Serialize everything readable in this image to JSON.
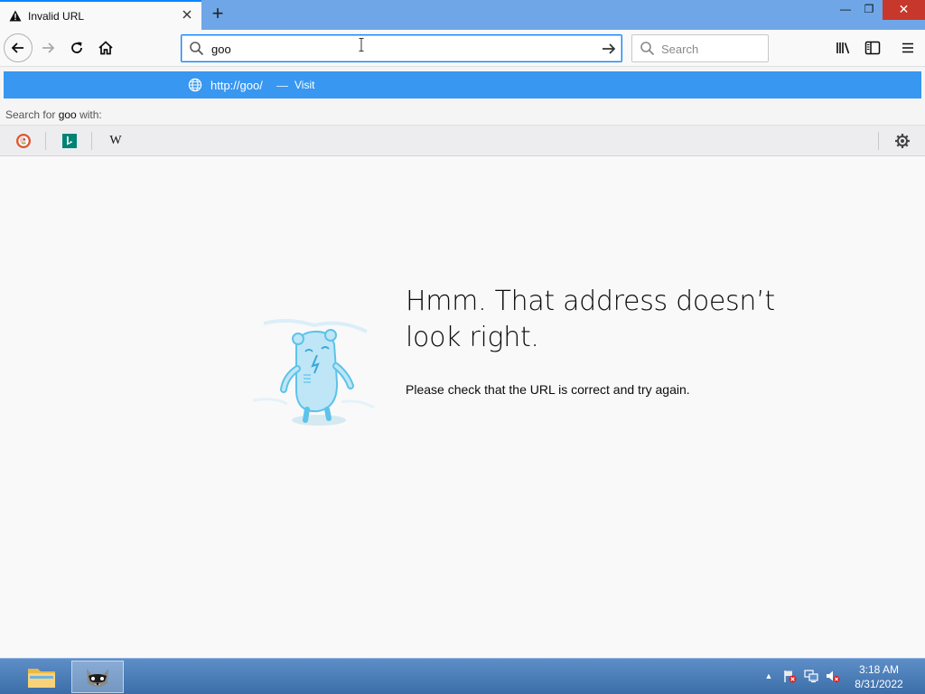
{
  "window": {
    "tab_title": "Invalid URL",
    "new_tab_symbol": "+",
    "minimize_symbol": "—",
    "maximize_symbol": "❐",
    "close_symbol": "✕"
  },
  "navbar": {
    "url_value": "goo",
    "search_placeholder": "Search"
  },
  "popup": {
    "url": "http://goo/",
    "dash": "—",
    "action": "Visit",
    "search_for_prefix": "Search for ",
    "search_term": "goo",
    "search_for_suffix": " with:",
    "engines": [
      "duckduckgo-icon",
      "bing-icon",
      "wikipedia-icon"
    ],
    "wiki_glyph": "W"
  },
  "error": {
    "title": "Hmm. That address doesn’t look right.",
    "text": "Please check that the URL is correct and try again."
  },
  "taskbar": {
    "time": "3:18 AM",
    "date": "8/31/2022",
    "tray_up": "▲"
  },
  "colors": {
    "accent": "#0a84ff",
    "popup_highlight": "#3897f0",
    "tabstrip": "#6fa6e8",
    "close_red": "#c7372b"
  }
}
